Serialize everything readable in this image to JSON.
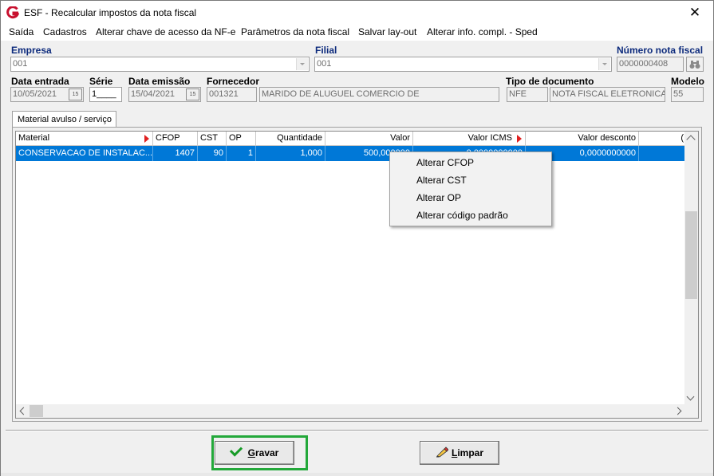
{
  "window": {
    "title": "ESF - Recalcular impostos da nota fiscal",
    "close_glyph": "✕"
  },
  "menu": [
    "Saída",
    "Cadastros",
    "Alterar chave de acesso da NF-e",
    "Parâmetros da nota fiscal",
    "Salvar lay-out",
    "Alterar info. compl. - Sped"
  ],
  "form": {
    "empresa": {
      "label": "Empresa",
      "value": "001"
    },
    "filial": {
      "label": "Filial",
      "value": "001"
    },
    "numero_nf": {
      "label": "Número nota fiscal",
      "value": "0000000408"
    },
    "data_entrada": {
      "label": "Data entrada",
      "value": "10/05/2021"
    },
    "serie": {
      "label": "Série",
      "value": "1____"
    },
    "data_emissao": {
      "label": "Data emissão",
      "value": "15/04/2021"
    },
    "fornecedor": {
      "label": "Fornecedor",
      "code": "001321",
      "name": "MARIDO DE ALUGUEL COMERCIO DE"
    },
    "tipo_documento": {
      "label": "Tipo de documento",
      "code": "NFE",
      "name": "NOTA FISCAL ELETRONICA"
    },
    "modelo": {
      "label": "Modelo",
      "value": "55"
    },
    "calendar_glyph": "15"
  },
  "tab": {
    "label": "Material avulso / serviço"
  },
  "grid": {
    "columns": [
      "Material",
      "CFOP",
      "CST",
      "OP",
      "Quantidade",
      "Valor",
      "Valor ICMS",
      "Valor desconto",
      "("
    ],
    "rows": [
      [
        "CONSERVACAO DE INSTALAC...",
        "1407",
        "90",
        "1",
        "1,000",
        "500,000000",
        "0,0000000000",
        "0,0000000000",
        ""
      ]
    ]
  },
  "context_menu": [
    "Alterar CFOP",
    "Alterar CST",
    "Alterar OP",
    "Alterar código padrão"
  ],
  "buttons": {
    "gravar": {
      "first": "G",
      "rest": "ravar"
    },
    "limpar": {
      "first": "L",
      "rest": "impar"
    }
  },
  "colors": {
    "selection": "#0078d7",
    "label_blue": "#0c2a7c",
    "highlight": "#23a83a",
    "sort_arrow": "#e02020"
  }
}
